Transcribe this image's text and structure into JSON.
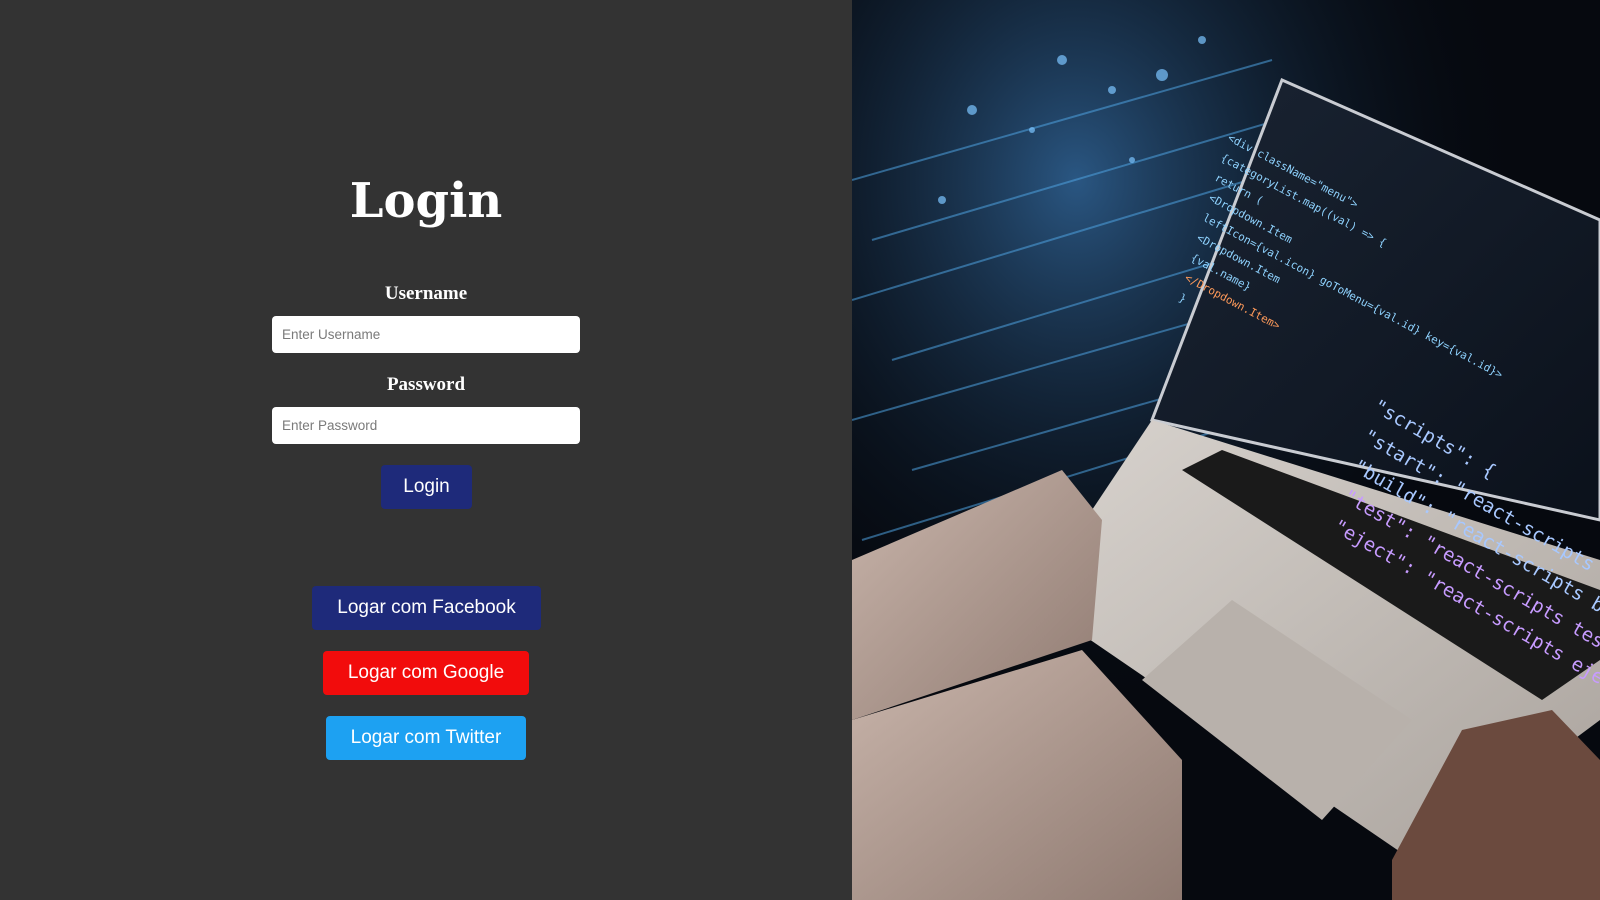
{
  "login": {
    "title": "Login",
    "username_label": "Username",
    "username_placeholder": "Enter Username",
    "password_label": "Password",
    "password_placeholder": "Enter Password",
    "submit_label": "Login"
  },
  "social": {
    "facebook_label": "Logar com Facebook",
    "google_label": "Logar com Google",
    "twitter_label": "Logar com Twitter"
  },
  "hero_image": {
    "code_lines": [
      "<div className=\"menu\">",
      "{categoryList.map((val) => {",
      "return (",
      "<Dropdown.Item",
      "leftIcon={val.icon} goToMenu={val.id} key={val.id}>",
      "<Dropdown.Item",
      "{val.name}",
      "</Dropdown.Item>",
      "}",
      "\"scripts\": {",
      "\"start\": \"react-scripts start\",",
      "\"build\": \"react-scripts build\",",
      "\"test\": \"react-scripts test\",",
      "\"eject\": \"react-scripts eject\""
    ]
  },
  "colors": {
    "background": "#333333",
    "primary_button": "#1e2a7a",
    "google_button": "#f20c0c",
    "twitter_button": "#1da1f2",
    "text": "#ffffff"
  }
}
